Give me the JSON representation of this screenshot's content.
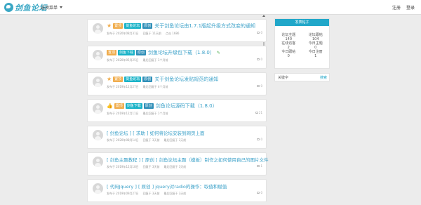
{
  "site": {
    "logo_text": "剑鱼论坛",
    "nav_menu": "选项菜单"
  },
  "header": {
    "links": [
      "注册",
      "登录"
    ]
  },
  "posts": [
    {
      "badges": [
        "置顶",
        "剑鱼论坛",
        "原创"
      ],
      "title": "关于剑鱼论坛由1.7.1版起升级方式改变的通知",
      "meta": [
        "发布于 2020年08月31日",
        "回复于 11天前",
        "点击 1686"
      ],
      "count": "0"
    },
    {
      "badges": [
        "置顶",
        "剑鱼下载",
        "原创"
      ],
      "title": "剑鱼论坛升级包下载（1.8.0）",
      "meta": [
        "发布于 2020年05月25日",
        "最后回复于 1个月前"
      ],
      "count": "0"
    },
    {
      "badges": [
        "置顶",
        "剑鱼论坛",
        "原创"
      ],
      "title": "关于剑鱼论坛发贴规范的通知",
      "meta": [
        "发布于 2019年12月27日",
        "最后回复于 4个月前"
      ],
      "count": "0"
    },
    {
      "badges": [
        "置顶",
        "剑鱼下载",
        "原创"
      ],
      "title": "剑鱼论坛源码下载（1.8.0）",
      "meta": [
        "发布于 2019年12月11日",
        "最后回复于 1个月前"
      ],
      "count": "21"
    },
    {
      "badges": [],
      "title": "[ 剑鱼论坛 ] [ 求助 ] 如何将论坛安装到网页上面",
      "meta": [
        "发布于 2020年08月14日",
        "回复于 3天前",
        "最后回复于 3天前"
      ],
      "count": "0"
    },
    {
      "badges": [],
      "title": "[ 剑鱼主题教程 ] [ 原创 ] 剑鱼论坛主题（模板）制作之如何使用自己的图片文件",
      "meta": [
        "发布于 2019年12月18日",
        "回复于 3天前",
        "最后回复于 3天前"
      ],
      "count": "1"
    },
    {
      "badges": [],
      "title": "[ 代码Jquery ] [ 原创 ] jquery对radio的操作：取值和赋值",
      "meta": [
        "发布于 2019年09月27日",
        "回复于 3天前",
        "最后回复于 3天前"
      ],
      "count": "0"
    }
  ],
  "sidebar": {
    "header": "发表帖子",
    "stats": [
      {
        "label": "论坛主题",
        "value": "140"
      },
      {
        "label": "论坛跟帖",
        "value": "104"
      },
      {
        "label": "在线访客",
        "value": "2"
      },
      {
        "label": "今日主题",
        "value": "0"
      },
      {
        "label": "今日跟帖",
        "value": "0"
      },
      {
        "label": "今日注册",
        "value": "1"
      }
    ],
    "search_label": "关键字",
    "search_button": "搜索"
  },
  "colors": {
    "accent": "#21a7c9",
    "badge_orange": "#f0ad4e",
    "badge_teal": "#1ab3c8",
    "title_link": "#3aa0c8"
  }
}
